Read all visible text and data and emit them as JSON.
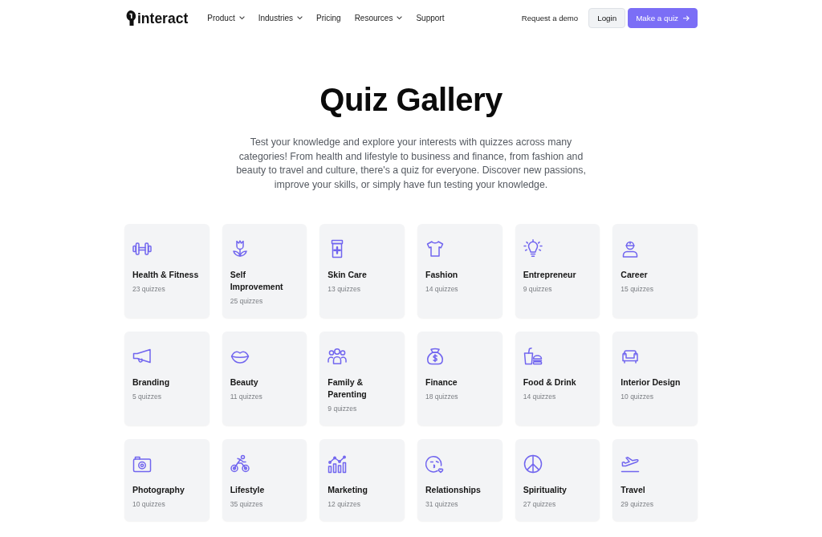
{
  "header": {
    "logo": "interact",
    "nav": [
      {
        "label": "Product",
        "dropdown": true
      },
      {
        "label": "Industries",
        "dropdown": true
      },
      {
        "label": "Pricing",
        "dropdown": false
      },
      {
        "label": "Resources",
        "dropdown": true
      },
      {
        "label": "Support",
        "dropdown": false
      }
    ],
    "actions": [
      {
        "label": "Request a demo",
        "kind": "link"
      },
      {
        "label": "Login",
        "kind": "secondary"
      },
      {
        "label": "Make a quiz",
        "kind": "primary"
      }
    ]
  },
  "hero": {
    "title": "Quiz Gallery",
    "description": "Test your knowledge and explore your interests with quizzes across many categories! From health and lifestyle to business and finance, from fashion and beauty to travel and culture, there's a quiz for everyone. Discover new passions, improve your skills, or simply have fun testing your knowledge."
  },
  "categories": [
    {
      "name": "Health & Fitness",
      "count": "23 quizzes"
    },
    {
      "name": "Self Improvement",
      "count": "25 quizzes"
    },
    {
      "name": "Skin Care",
      "count": "13 quizzes"
    },
    {
      "name": "Fashion",
      "count": "14 quizzes"
    },
    {
      "name": "Entrepreneur",
      "count": "9 quizzes"
    },
    {
      "name": "Career",
      "count": "15 quizzes"
    },
    {
      "name": "Branding",
      "count": "5 quizzes"
    },
    {
      "name": "Beauty",
      "count": "11 quizzes"
    },
    {
      "name": "Family & Parenting",
      "count": "9 quizzes"
    },
    {
      "name": "Finance",
      "count": "18 quizzes"
    },
    {
      "name": "Food & Drink",
      "count": "14 quizzes"
    },
    {
      "name": "Interior Design",
      "count": "10 quizzes"
    },
    {
      "name": "Photography",
      "count": "10 quizzes"
    },
    {
      "name": "Lifestyle",
      "count": "35 quizzes"
    },
    {
      "name": "Marketing",
      "count": "12 quizzes"
    },
    {
      "name": "Relationships",
      "count": "31 quizzes"
    },
    {
      "name": "Spirituality",
      "count": "27 quizzes"
    },
    {
      "name": "Travel",
      "count": "29 quizzes"
    }
  ]
}
